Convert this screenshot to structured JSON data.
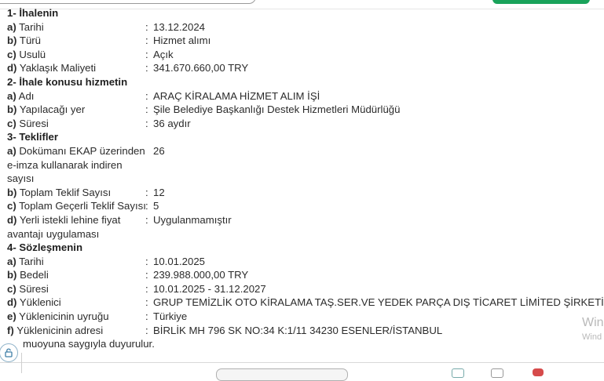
{
  "sections": [
    {
      "title": "1- İhalenin",
      "rows": [
        {
          "key": "a)",
          "label": "Tarihi",
          "value": "13.12.2024"
        },
        {
          "key": "b)",
          "label": "Türü",
          "value": "Hizmet alımı"
        },
        {
          "key": "c)",
          "label": "Usulü",
          "value": "Açık"
        },
        {
          "key": "d)",
          "label": "Yaklaşık Maliyeti",
          "value": "341.670.660,00 TRY"
        }
      ]
    },
    {
      "title": "2- İhale konusu hizmetin",
      "rows": [
        {
          "key": "a)",
          "label": "Adı",
          "value": "ARAÇ KİRALAMA HİZMET ALIM İŞİ"
        },
        {
          "key": "b)",
          "label": "Yapılacağı yer",
          "value": "Şile Belediye Başkanlığı Destek Hizmetleri Müdürlüğü"
        },
        {
          "key": "c)",
          "label": "Süresi",
          "value": "36 aydır"
        }
      ]
    },
    {
      "title": "3- Teklifler",
      "rows": [
        {
          "key": "a)",
          "label": "Dokümanı EKAP üzerinden e-imza kullanarak indiren sayısı",
          "value": "26"
        },
        {
          "key": "b)",
          "label": "Toplam Teklif Sayısı",
          "value": "12"
        },
        {
          "key": "c)",
          "label": "Toplam Geçerli Teklif Sayısı",
          "value": "5"
        },
        {
          "key": "d)",
          "label": "Yerli istekli lehine fiyat avantajı uygulaması",
          "value": "Uygulanmamıştır"
        }
      ]
    },
    {
      "title": "4- Sözleşmenin",
      "rows": [
        {
          "key": "a)",
          "label": "Tarihi",
          "value": "10.01.2025"
        },
        {
          "key": "b)",
          "label": "Bedeli",
          "value": "239.988.000,00 TRY"
        },
        {
          "key": "c)",
          "label": "Süresi",
          "value": "10.01.2025 - 31.12.2027"
        },
        {
          "key": "d)",
          "label": "Yüklenici",
          "value": "GRUP TEMİZLİK OTO KİRALAMA TAŞ.SER.VE YEDEK PARÇA DIŞ TİCARET LİMİTED ŞİRKETİ."
        },
        {
          "key": "e)",
          "label": "Yüklenicinin uyruğu",
          "value": "Türkiye"
        },
        {
          "key": "f)",
          "label": "Yüklenicinin adresi",
          "value": "BİRLİK MH 796 SK NO:34 K:1/11 34230 ESENLER/İSTANBUL"
        }
      ]
    }
  ],
  "footer_text": "muoyuna saygıyla duyurulur.",
  "watermark": {
    "line1": "Win",
    "line2": "Wind"
  },
  "icons": {
    "lock": "lock-icon"
  },
  "colors": {
    "accent_green": "#1aa35b"
  }
}
